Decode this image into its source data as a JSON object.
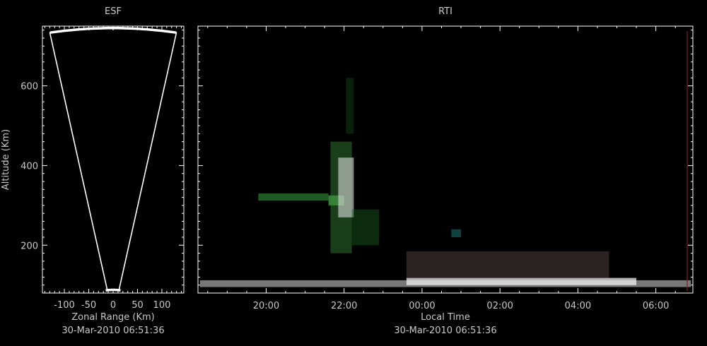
{
  "colors": {
    "background": "#000000",
    "axis": "#ffffff",
    "text": "#c8c8c8",
    "echo_green": "#2e7d32",
    "echo_white": "#e0e0e0"
  },
  "chart_data": [
    {
      "type": "line",
      "title": "ESF",
      "xlabel": "Zonal Range (Km)",
      "ylabel": "Altitude (Km)",
      "footer": "30-Mar-2010 06:51:36",
      "xlim": [
        -145,
        145
      ],
      "ylim": [
        80,
        750
      ],
      "xticks": [
        -100,
        -50,
        0,
        50,
        100
      ],
      "xtick_labels": [
        "-100",
        "-50",
        "0",
        "50",
        "100"
      ],
      "yticks": [
        200,
        400,
        600
      ],
      "ytick_labels": [
        "200",
        "400",
        "600"
      ],
      "series": [
        {
          "x": [
            -130,
            -12,
            12,
            130
          ],
          "y": [
            735,
            88,
            88,
            735
          ]
        }
      ],
      "arcs": [
        {
          "range_km": 745,
          "half_angle_deg": 10
        },
        {
          "range_km": 88,
          "half_angle_deg": 10
        }
      ]
    },
    {
      "type": "heatmap",
      "title": "RTI",
      "xlabel": "Local Time",
      "footer": "30-Mar-2010 06:51:36",
      "xlim": [
        18.25,
        30.95
      ],
      "ylim": [
        80,
        750
      ],
      "xticks": [
        20,
        22,
        24,
        26,
        28,
        30
      ],
      "xtick_labels": [
        "20:00",
        "22:00",
        "00:00",
        "02:00",
        "04:00",
        "06:00"
      ],
      "yticks": [
        200,
        400,
        600
      ],
      "ytick_labels": [
        "200",
        "400",
        "600"
      ],
      "echo_regions": [
        {
          "t0": 18.3,
          "t1": 30.9,
          "h0": 95,
          "h1": 112,
          "color": "#d8d8d8",
          "opacity": 0.55
        },
        {
          "t0": 23.6,
          "t1": 29.5,
          "h0": 100,
          "h1": 118,
          "color": "#f0f0f0",
          "opacity": 0.75
        },
        {
          "t0": 23.6,
          "t1": 28.8,
          "h0": 118,
          "h1": 185,
          "color": "#7a6060",
          "opacity": 0.35
        },
        {
          "t0": 19.8,
          "t1": 21.6,
          "h0": 312,
          "h1": 330,
          "color": "#2e7d32",
          "opacity": 0.7
        },
        {
          "t0": 21.6,
          "t1": 22.0,
          "h0": 300,
          "h1": 325,
          "color": "#4caf50",
          "opacity": 0.7
        },
        {
          "t0": 21.65,
          "t1": 22.2,
          "h0": 180,
          "h1": 460,
          "color": "#3a8a3a",
          "opacity": 0.45
        },
        {
          "t0": 21.85,
          "t1": 22.25,
          "h0": 270,
          "h1": 420,
          "color": "#dddddd",
          "opacity": 0.6
        },
        {
          "t0": 22.2,
          "t1": 22.9,
          "h0": 200,
          "h1": 290,
          "color": "#1b5e20",
          "opacity": 0.45
        },
        {
          "t0": 22.05,
          "t1": 22.25,
          "h0": 480,
          "h1": 620,
          "color": "#1b5e20",
          "opacity": 0.35
        },
        {
          "t0": 24.75,
          "t1": 25.0,
          "h0": 220,
          "h1": 240,
          "color": "#26a69a",
          "opacity": 0.4
        }
      ]
    }
  ]
}
